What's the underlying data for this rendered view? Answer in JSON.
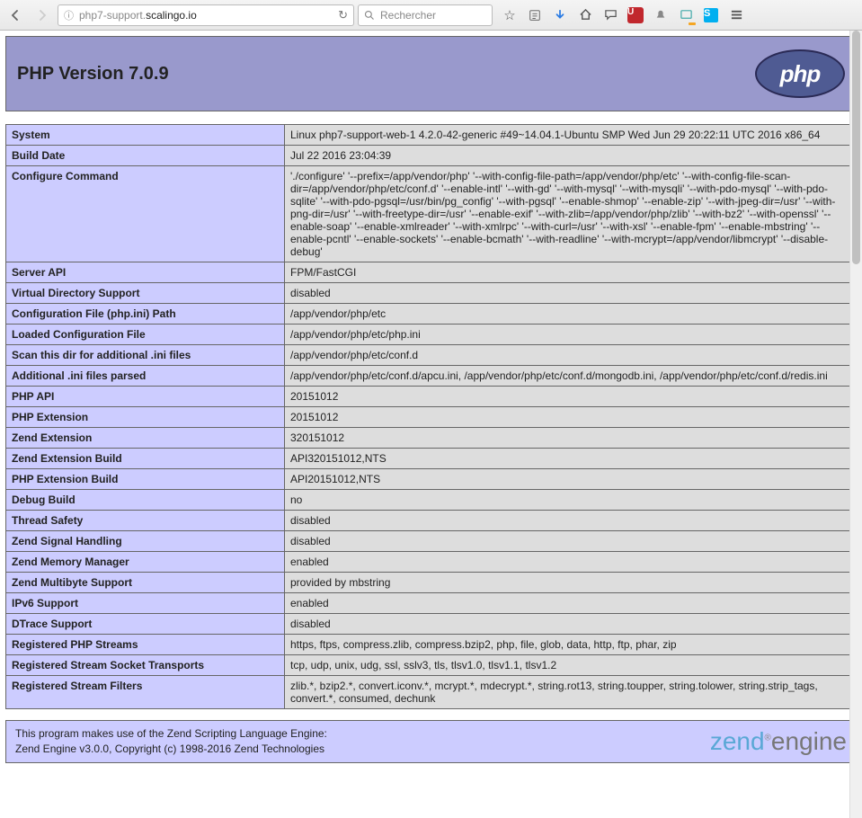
{
  "browser": {
    "url_prefix": "php7-support.",
    "url_domain": "scalingo.io",
    "search_placeholder": "Rechercher"
  },
  "header": {
    "title": "PHP Version 7.0.9",
    "logo_text": "php"
  },
  "rows": [
    {
      "k": "System",
      "v": "Linux php7-support-web-1 4.2.0-42-generic #49~14.04.1-Ubuntu SMP Wed Jun 29 20:22:11 UTC 2016 x86_64"
    },
    {
      "k": "Build Date",
      "v": "Jul 22 2016 23:04:39"
    },
    {
      "k": "Configure Command",
      "v": "'./configure' '--prefix=/app/vendor/php' '--with-config-file-path=/app/vendor/php/etc' '--with-config-file-scan-dir=/app/vendor/php/etc/conf.d' '--enable-intl' '--with-gd' '--with-mysql' '--with-mysqli' '--with-pdo-mysql' '--with-pdo-sqlite' '--with-pdo-pgsql=/usr/bin/pg_config' '--with-pgsql' '--enable-shmop' '--enable-zip' '--with-jpeg-dir=/usr' '--with-png-dir=/usr' '--with-freetype-dir=/usr' '--enable-exif' '--with-zlib=/app/vendor/php/zlib' '--with-bz2' '--with-openssl' '--enable-soap' '--enable-xmlreader' '--with-xmlrpc' '--with-curl=/usr' '--with-xsl' '--enable-fpm' '--enable-mbstring' '--enable-pcntl' '--enable-sockets' '--enable-bcmath' '--with-readline' '--with-mcrypt=/app/vendor/libmcrypt' '--disable-debug'"
    },
    {
      "k": "Server API",
      "v": "FPM/FastCGI"
    },
    {
      "k": "Virtual Directory Support",
      "v": "disabled"
    },
    {
      "k": "Configuration File (php.ini) Path",
      "v": "/app/vendor/php/etc"
    },
    {
      "k": "Loaded Configuration File",
      "v": "/app/vendor/php/etc/php.ini"
    },
    {
      "k": "Scan this dir for additional .ini files",
      "v": "/app/vendor/php/etc/conf.d"
    },
    {
      "k": "Additional .ini files parsed",
      "v": "/app/vendor/php/etc/conf.d/apcu.ini, /app/vendor/php/etc/conf.d/mongodb.ini, /app/vendor/php/etc/conf.d/redis.ini"
    },
    {
      "k": "PHP API",
      "v": "20151012"
    },
    {
      "k": "PHP Extension",
      "v": "20151012"
    },
    {
      "k": "Zend Extension",
      "v": "320151012"
    },
    {
      "k": "Zend Extension Build",
      "v": "API320151012,NTS"
    },
    {
      "k": "PHP Extension Build",
      "v": "API20151012,NTS"
    },
    {
      "k": "Debug Build",
      "v": "no"
    },
    {
      "k": "Thread Safety",
      "v": "disabled"
    },
    {
      "k": "Zend Signal Handling",
      "v": "disabled"
    },
    {
      "k": "Zend Memory Manager",
      "v": "enabled"
    },
    {
      "k": "Zend Multibyte Support",
      "v": "provided by mbstring"
    },
    {
      "k": "IPv6 Support",
      "v": "enabled"
    },
    {
      "k": "DTrace Support",
      "v": "disabled"
    },
    {
      "k": "Registered PHP Streams",
      "v": "https, ftps, compress.zlib, compress.bzip2, php, file, glob, data, http, ftp, phar, zip"
    },
    {
      "k": "Registered Stream Socket Transports",
      "v": "tcp, udp, unix, udg, ssl, sslv3, tls, tlsv1.0, tlsv1.1, tlsv1.2"
    },
    {
      "k": "Registered Stream Filters",
      "v": "zlib.*, bzip2.*, convert.iconv.*, mcrypt.*, mdecrypt.*, string.rot13, string.toupper, string.tolower, string.strip_tags, convert.*, consumed, dechunk"
    }
  ],
  "zend": {
    "line1": "This program makes use of the Zend Scripting Language Engine:",
    "line2": "Zend Engine v3.0.0, Copyright (c) 1998-2016 Zend Technologies",
    "logo_prefix": "zend",
    "logo_suffix": "engine"
  }
}
